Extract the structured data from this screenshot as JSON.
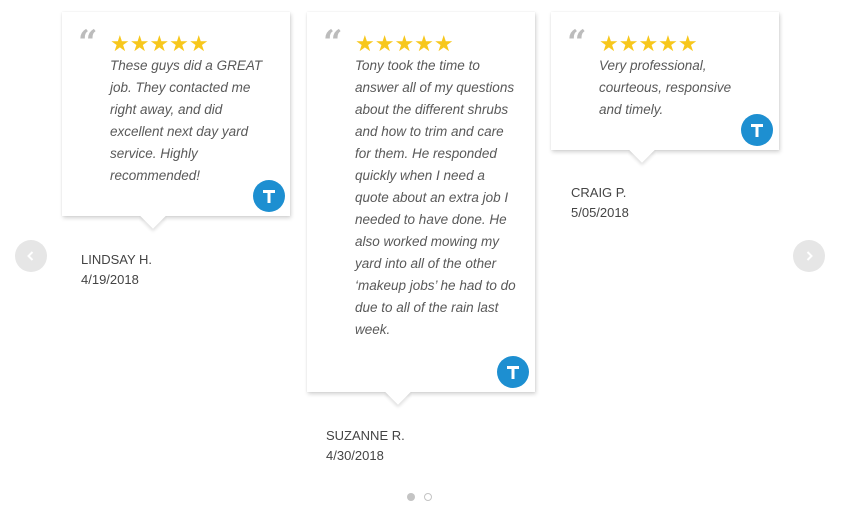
{
  "reviews": [
    {
      "stars": "★★★★★",
      "text": "These guys did a GREAT job. They contacted me right away, and did excellent next day yard service. Highly recommended!",
      "name": "LINDSAY H.",
      "date": "4/19/2018"
    },
    {
      "stars": "★★★★★",
      "text": "Tony took the time to answer all of my questions about the different shrubs and how to trim and care for them. He responded quickly when I need a quote about an extra job I needed to have done. He also worked mowing my yard into all of the other ‘makeup jobs’ he had to do due to all of the rain last week.",
      "name": "SUZANNE R.",
      "date": "4/30/2018"
    },
    {
      "stars": "★★★★★",
      "text": "Very professional, courteous, responsive and timely.",
      "name": "CRAIG P.",
      "date": "5/05/2018"
    }
  ],
  "icons": {
    "quote": "“",
    "badge": "thumbtack-badge-icon",
    "prev": "chevron-left-icon",
    "next": "chevron-right-icon"
  },
  "colors": {
    "star": "#f7c71c",
    "badge": "#1d8fd1",
    "arrow_bg": "#e6e6e6",
    "quote": "#bcbcbc"
  },
  "pagination": {
    "current_page": 1,
    "total_pages": 2
  }
}
